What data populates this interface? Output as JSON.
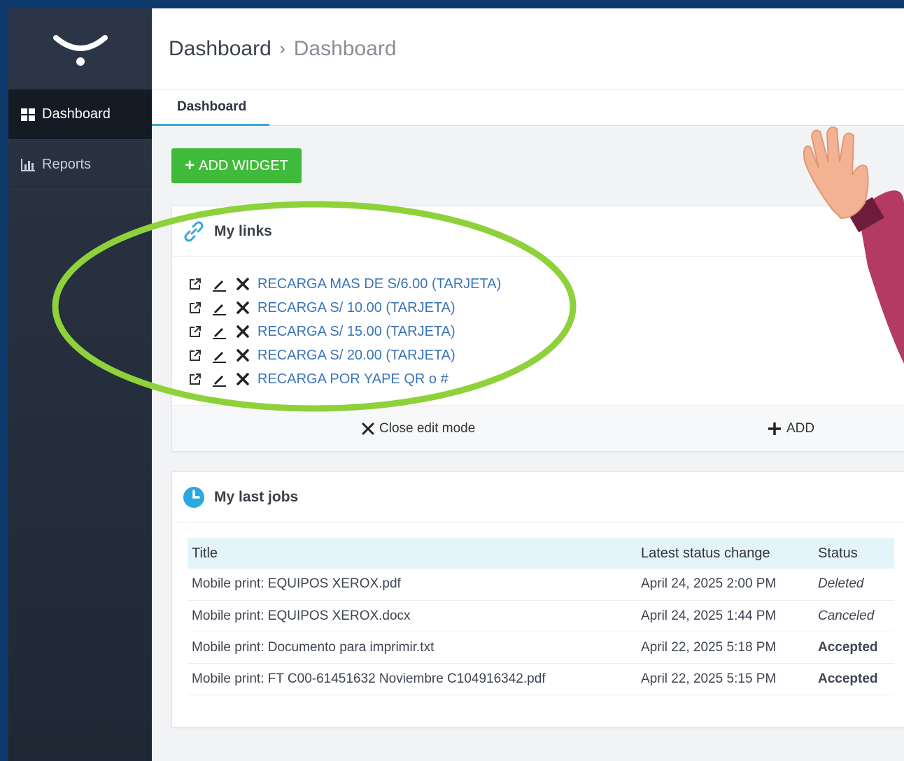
{
  "sidebar": {
    "items": [
      {
        "label": "Dashboard",
        "icon": "dashboard-grid-icon",
        "active": true
      },
      {
        "label": "Reports",
        "icon": "bar-chart-icon",
        "active": false
      }
    ]
  },
  "header": {
    "breadcrumb": [
      "Dashboard",
      "Dashboard"
    ],
    "separator": "›"
  },
  "tabs": [
    {
      "label": "Dashboard",
      "active": true
    }
  ],
  "toolbar": {
    "add_widget_label": "ADD WIDGET"
  },
  "links_widget": {
    "title": "My links",
    "links": [
      "RECARGA MAS DE S/6.00 (TARJETA)",
      "RECARGA S/ 10.00 (TARJETA)",
      "RECARGA S/ 15.00 (TARJETA)",
      "RECARGA S/ 20.00 (TARJETA)",
      "RECARGA POR YAPE QR o #"
    ],
    "close_edit_label": "Close edit mode",
    "add_label": "ADD"
  },
  "jobs_widget": {
    "title": "My last jobs",
    "columns": [
      "Title",
      "Latest status change",
      "Status"
    ],
    "rows": [
      {
        "title": "Mobile print: EQUIPOS XEROX.pdf",
        "date": "April 24, 2025 2:00 PM",
        "status": "Deleted"
      },
      {
        "title": "Mobile print: EQUIPOS XEROX.docx",
        "date": "April 24, 2025 1:44 PM",
        "status": "Canceled"
      },
      {
        "title": "Mobile print: Documento para imprimir.txt",
        "date": "April 22, 2025 5:18 PM",
        "status": "Accepted"
      },
      {
        "title": "Mobile print: FT C00-61451632 Noviembre C104916342.pdf",
        "date": "April 22, 2025 5:15 PM",
        "status": "Accepted"
      }
    ]
  },
  "colors": {
    "frame": "#0d3a6b",
    "sidebar": "#2b3444",
    "accent_green": "#3fba3a",
    "link_blue": "#3a74b8",
    "highlight_ellipse": "#8ed13a",
    "tab_underline": "#3aa6d8"
  }
}
